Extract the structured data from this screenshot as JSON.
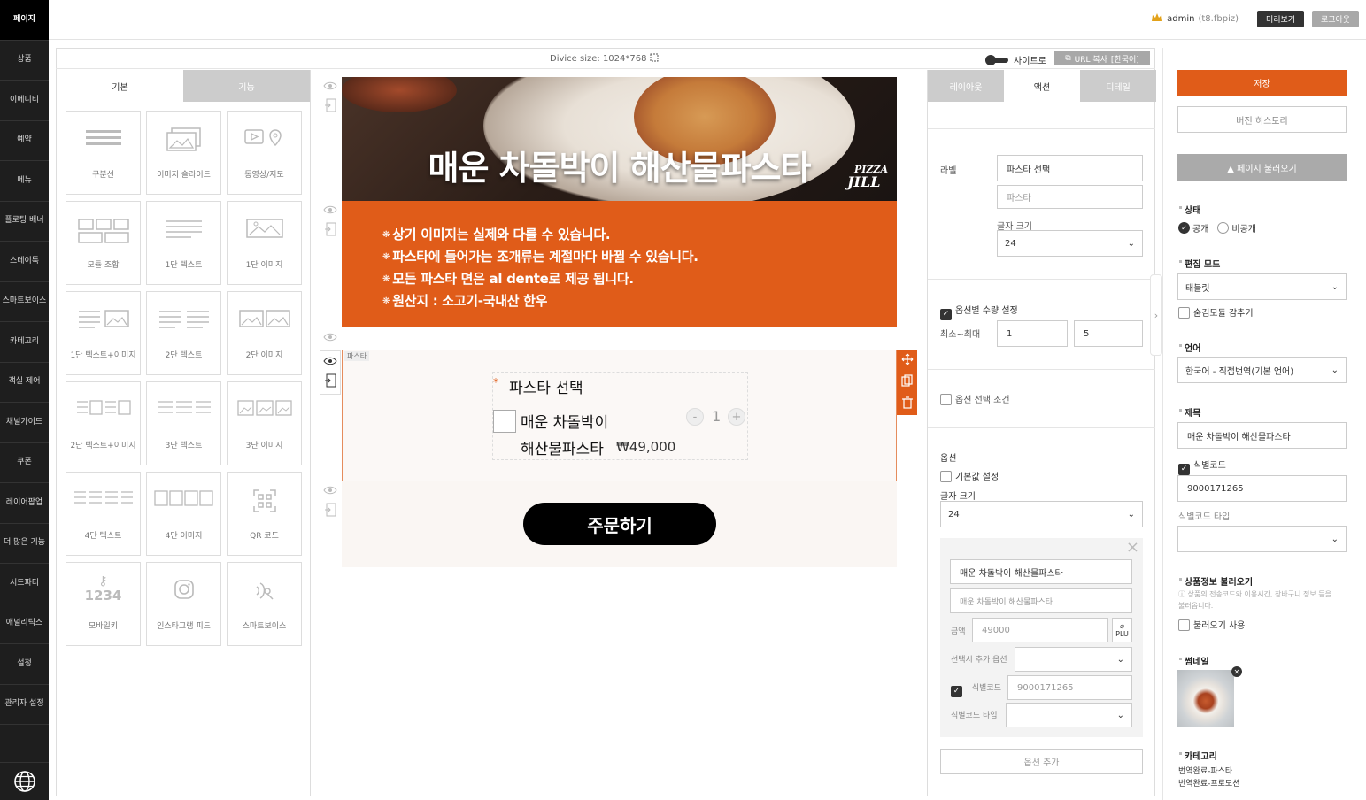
{
  "nav": {
    "items": [
      "페이지",
      "상품",
      "이메니티",
      "예약",
      "메뉴",
      "플로팅 배너",
      "스테이툭",
      "스마트보이스",
      "카테고리",
      "객실 제어",
      "채널가이드",
      "쿠폰",
      "레이어팝업",
      "더 많은 기능",
      "서드파티",
      "애널리틱스",
      "설정",
      "관리자 설정"
    ]
  },
  "topbar": {
    "admin": "admin",
    "admin_sub": "(t8.fbpiz)",
    "preview": "미리보기",
    "logout": "로그아웃"
  },
  "devbar": {
    "device_size": "Divice size: 1024*768",
    "site_toggle": "사이트로",
    "url_copy": "URL 복사",
    "lang": "[한국어]"
  },
  "left": {
    "tabs": [
      "기본",
      "기능"
    ],
    "tiles": [
      "구분선",
      "이미지 슬라이드",
      "동영상/지도",
      "모듈 조합",
      "1단 텍스트",
      "1단 이미지",
      "1단 텍스트+이미지",
      "2단 텍스트",
      "2단 이미지",
      "2단 텍스트+이미지",
      "3단 텍스트",
      "3단 이미지",
      "4단 텍스트",
      "4단 이미지",
      "QR 코드",
      "모바일키",
      "인스타그램 피드",
      "스마트보이스"
    ],
    "mobile_key_digits": "1234"
  },
  "preview": {
    "hero_title": "매운 차돌박이 해산물파스타",
    "brand_line1": "PIZZA",
    "brand_line2": "JILL",
    "notices": [
      "상기 이미지는 실제와 다를 수 있습니다.",
      "파스타에 들어가는 조개류는 계절마다 바뀔 수 있습니다.",
      "모든 파스타 면은 al dente로 제공 됩니다.",
      "원산지 : 소고기-국내산 한우"
    ],
    "option_block_label": "파스타",
    "required_mark": "*",
    "option_title": "파스타 선택",
    "option_name_1": "매운 차돌박이",
    "option_name_2": "해산물파스타",
    "option_price": "₩49,000",
    "qty": "1",
    "minus": "-",
    "plus": "+",
    "order_button": "주문하기"
  },
  "rpanel": {
    "tabs": [
      "레이아웃",
      "액션",
      "디테일"
    ],
    "label_title": "라벨",
    "label_value": "파스타 선택",
    "label_placeholder": "파스타",
    "font_size_label": "글자 크기",
    "font_size_value": "24",
    "qty_setting": "옵션별 수량 설정",
    "minmax_label": "최소~최대",
    "min": "1",
    "max": "5",
    "option_condition": "옵션 선택 조건",
    "option_label": "옵션",
    "default_setting": "기본값 설정",
    "font_size_label2": "글자 크기",
    "font_size_value2": "24",
    "opt_name": "매운 차돌박이 해산물파스타",
    "opt_name_ph": "매운 차돌박이 해산물파스타",
    "price_label": "금액",
    "price_value": "49000",
    "plu": "PLU",
    "extra_option_label": "선택시 추가 옵션",
    "code_label": "식별코드",
    "code_value": "9000171265",
    "code_type_label": "식별코드 타입",
    "add_option": "옵션 추가",
    "close": "×"
  },
  "rightcol": {
    "save": "저장",
    "history": "버전 히스토리",
    "load_page": "▲ 페이지 불러오기",
    "status_title": "상태",
    "public": "공개",
    "private": "비공개",
    "edit_mode_title": "편집 모드",
    "edit_mode_value": "태블릿",
    "hide_module": "숨김모듈 감추기",
    "lang_title": "언어",
    "lang_value": "한국어 - 직접번역(기본 언어)",
    "title_title": "제목",
    "title_value": "매운 차돌박이 해산물파스타",
    "code_check": "식별코드",
    "code_value": "9000171265",
    "code_type": "식별코드 타입",
    "product_info_title": "상품정보 불러오기",
    "product_info_desc": "ⓘ 상품의 전송코드와 이용시간, 장바구니 정보 등을 불러옵니다.",
    "load_use": "불러오기 사용",
    "thumb_title": "썸네일",
    "category_title": "카테고리",
    "categories": [
      "번역완료-파스타",
      "번역완료-프로모션"
    ]
  },
  "colors": {
    "accent": "#e05c19",
    "dark": "#1e1e1e",
    "button_gray": "#a8a8a8"
  }
}
